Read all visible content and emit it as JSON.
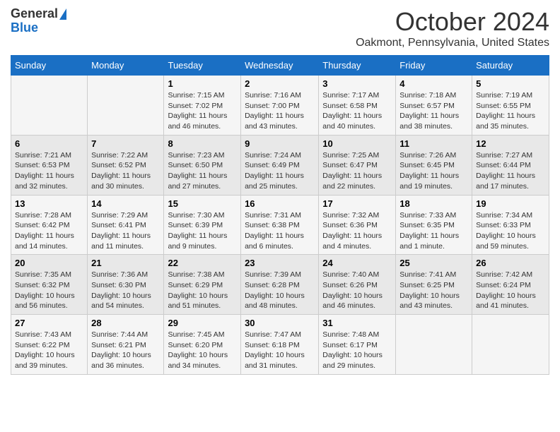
{
  "header": {
    "logo_line1": "General",
    "logo_line2": "Blue",
    "month": "October 2024",
    "location": "Oakmont, Pennsylvania, United States"
  },
  "days_of_week": [
    "Sunday",
    "Monday",
    "Tuesday",
    "Wednesday",
    "Thursday",
    "Friday",
    "Saturday"
  ],
  "weeks": [
    [
      {
        "day": "",
        "content": ""
      },
      {
        "day": "",
        "content": ""
      },
      {
        "day": "1",
        "content": "Sunrise: 7:15 AM\nSunset: 7:02 PM\nDaylight: 11 hours and 46 minutes."
      },
      {
        "day": "2",
        "content": "Sunrise: 7:16 AM\nSunset: 7:00 PM\nDaylight: 11 hours and 43 minutes."
      },
      {
        "day": "3",
        "content": "Sunrise: 7:17 AM\nSunset: 6:58 PM\nDaylight: 11 hours and 40 minutes."
      },
      {
        "day": "4",
        "content": "Sunrise: 7:18 AM\nSunset: 6:57 PM\nDaylight: 11 hours and 38 minutes."
      },
      {
        "day": "5",
        "content": "Sunrise: 7:19 AM\nSunset: 6:55 PM\nDaylight: 11 hours and 35 minutes."
      }
    ],
    [
      {
        "day": "6",
        "content": "Sunrise: 7:21 AM\nSunset: 6:53 PM\nDaylight: 11 hours and 32 minutes."
      },
      {
        "day": "7",
        "content": "Sunrise: 7:22 AM\nSunset: 6:52 PM\nDaylight: 11 hours and 30 minutes."
      },
      {
        "day": "8",
        "content": "Sunrise: 7:23 AM\nSunset: 6:50 PM\nDaylight: 11 hours and 27 minutes."
      },
      {
        "day": "9",
        "content": "Sunrise: 7:24 AM\nSunset: 6:49 PM\nDaylight: 11 hours and 25 minutes."
      },
      {
        "day": "10",
        "content": "Sunrise: 7:25 AM\nSunset: 6:47 PM\nDaylight: 11 hours and 22 minutes."
      },
      {
        "day": "11",
        "content": "Sunrise: 7:26 AM\nSunset: 6:45 PM\nDaylight: 11 hours and 19 minutes."
      },
      {
        "day": "12",
        "content": "Sunrise: 7:27 AM\nSunset: 6:44 PM\nDaylight: 11 hours and 17 minutes."
      }
    ],
    [
      {
        "day": "13",
        "content": "Sunrise: 7:28 AM\nSunset: 6:42 PM\nDaylight: 11 hours and 14 minutes."
      },
      {
        "day": "14",
        "content": "Sunrise: 7:29 AM\nSunset: 6:41 PM\nDaylight: 11 hours and 11 minutes."
      },
      {
        "day": "15",
        "content": "Sunrise: 7:30 AM\nSunset: 6:39 PM\nDaylight: 11 hours and 9 minutes."
      },
      {
        "day": "16",
        "content": "Sunrise: 7:31 AM\nSunset: 6:38 PM\nDaylight: 11 hours and 6 minutes."
      },
      {
        "day": "17",
        "content": "Sunrise: 7:32 AM\nSunset: 6:36 PM\nDaylight: 11 hours and 4 minutes."
      },
      {
        "day": "18",
        "content": "Sunrise: 7:33 AM\nSunset: 6:35 PM\nDaylight: 11 hours and 1 minute."
      },
      {
        "day": "19",
        "content": "Sunrise: 7:34 AM\nSunset: 6:33 PM\nDaylight: 10 hours and 59 minutes."
      }
    ],
    [
      {
        "day": "20",
        "content": "Sunrise: 7:35 AM\nSunset: 6:32 PM\nDaylight: 10 hours and 56 minutes."
      },
      {
        "day": "21",
        "content": "Sunrise: 7:36 AM\nSunset: 6:30 PM\nDaylight: 10 hours and 54 minutes."
      },
      {
        "day": "22",
        "content": "Sunrise: 7:38 AM\nSunset: 6:29 PM\nDaylight: 10 hours and 51 minutes."
      },
      {
        "day": "23",
        "content": "Sunrise: 7:39 AM\nSunset: 6:28 PM\nDaylight: 10 hours and 48 minutes."
      },
      {
        "day": "24",
        "content": "Sunrise: 7:40 AM\nSunset: 6:26 PM\nDaylight: 10 hours and 46 minutes."
      },
      {
        "day": "25",
        "content": "Sunrise: 7:41 AM\nSunset: 6:25 PM\nDaylight: 10 hours and 43 minutes."
      },
      {
        "day": "26",
        "content": "Sunrise: 7:42 AM\nSunset: 6:24 PM\nDaylight: 10 hours and 41 minutes."
      }
    ],
    [
      {
        "day": "27",
        "content": "Sunrise: 7:43 AM\nSunset: 6:22 PM\nDaylight: 10 hours and 39 minutes."
      },
      {
        "day": "28",
        "content": "Sunrise: 7:44 AM\nSunset: 6:21 PM\nDaylight: 10 hours and 36 minutes."
      },
      {
        "day": "29",
        "content": "Sunrise: 7:45 AM\nSunset: 6:20 PM\nDaylight: 10 hours and 34 minutes."
      },
      {
        "day": "30",
        "content": "Sunrise: 7:47 AM\nSunset: 6:18 PM\nDaylight: 10 hours and 31 minutes."
      },
      {
        "day": "31",
        "content": "Sunrise: 7:48 AM\nSunset: 6:17 PM\nDaylight: 10 hours and 29 minutes."
      },
      {
        "day": "",
        "content": ""
      },
      {
        "day": "",
        "content": ""
      }
    ]
  ]
}
